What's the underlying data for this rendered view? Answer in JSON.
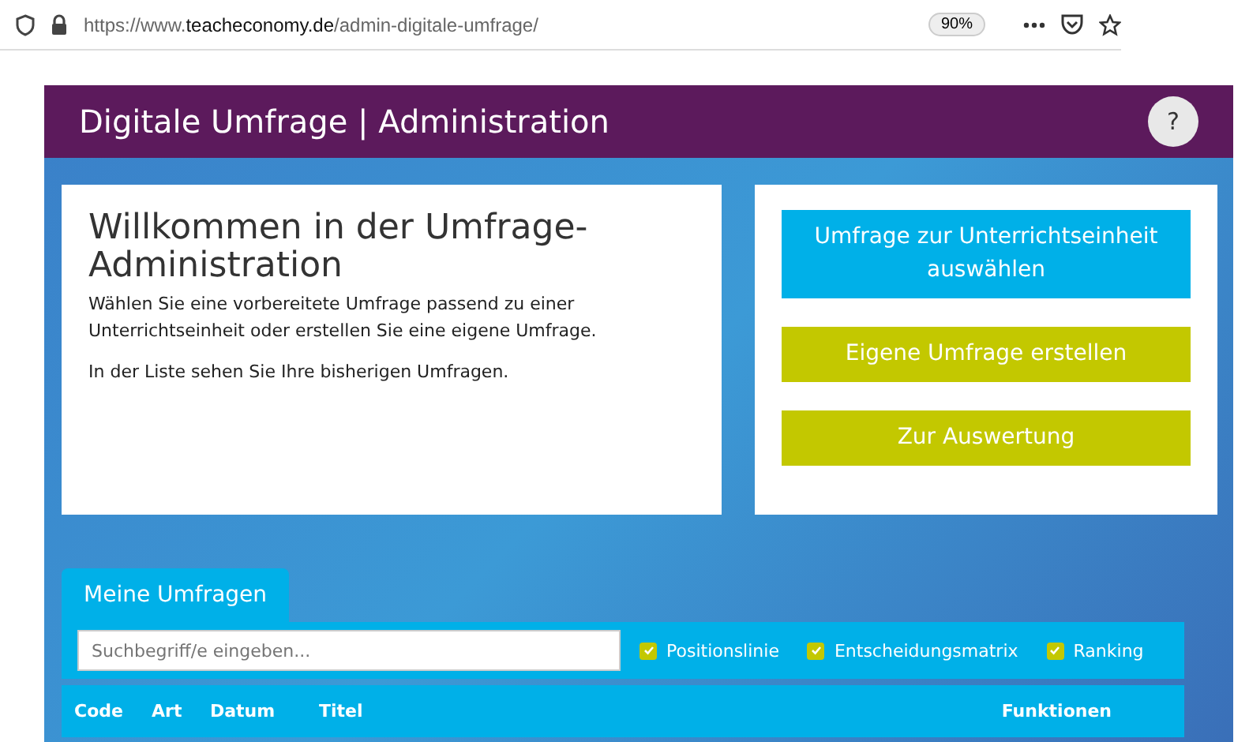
{
  "browser": {
    "url_prefix": "https://www.",
    "url_host": "teacheconomy.de",
    "url_path": "/admin-digitale-umfrage/",
    "zoom": "90%"
  },
  "header": {
    "title": "Digitale Umfrage | Administration",
    "help": "?"
  },
  "welcome": {
    "title": "Willkommen in der Umfrage-Administration",
    "paragraphs": [
      "Wählen Sie eine vorbereitete Umfrage passend zu einer Unterrichtseinheit oder erstellen Sie eine eigene Umfrage.",
      "In der Liste sehen Sie Ihre bisherigen Umfragen."
    ]
  },
  "actions": [
    {
      "label": "Umfrage zur Unterrichtseinheit auswählen",
      "kind": "primary"
    },
    {
      "label": "Eigene Umfrage erstellen",
      "kind": "secondary"
    },
    {
      "label": "Zur Auswertung",
      "kind": "secondary"
    }
  ],
  "tabs": [
    {
      "label": "Meine Umfragen",
      "selected": true
    }
  ],
  "search": {
    "placeholder": "Suchbegriff/e eingeben..."
  },
  "filters": [
    {
      "label": "Positionslinie",
      "checked": true
    },
    {
      "label": "Entscheidungsmatrix",
      "checked": true
    },
    {
      "label": "Ranking",
      "checked": true
    }
  ],
  "table": {
    "columns": [
      "Code",
      "Art",
      "Datum",
      "Titel",
      "Funktionen"
    ]
  }
}
